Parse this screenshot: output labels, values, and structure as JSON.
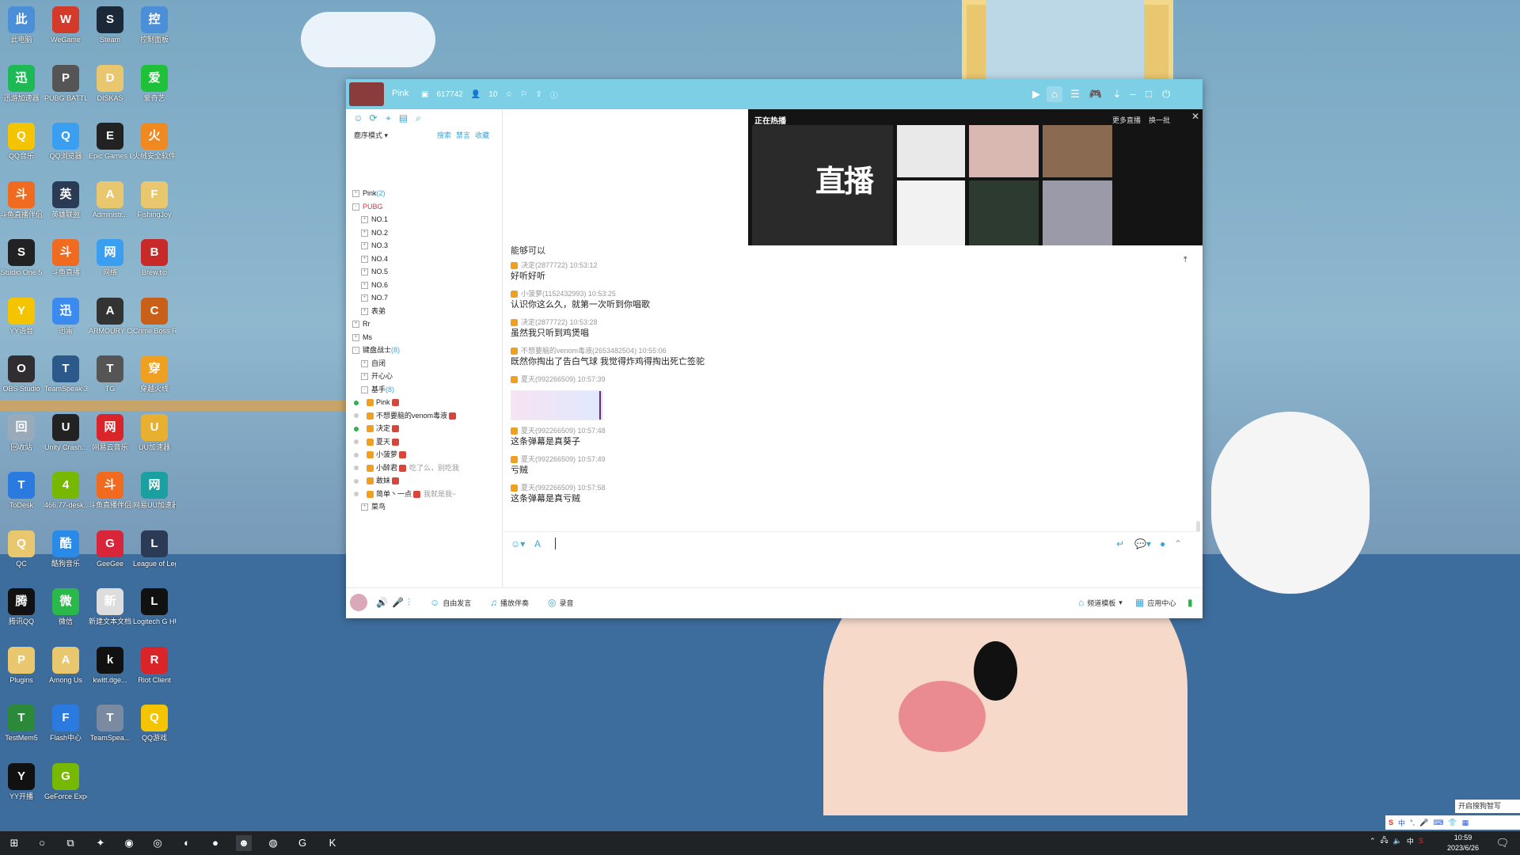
{
  "desktop": {
    "icons": [
      {
        "label": "此电脑",
        "color": "#4a8fd8"
      },
      {
        "label": "WeGame",
        "color": "#d43a2a"
      },
      {
        "label": "Steam",
        "color": "#1b2838"
      },
      {
        "label": "控制面板",
        "color": "#4a8fd8"
      },
      {
        "label": "迅游加速器",
        "color": "#1db954"
      },
      {
        "label": "PUBG BATTLEGR...",
        "color": "#555"
      },
      {
        "label": "DISKAS",
        "color": "#e8c76f"
      },
      {
        "label": "爱奇艺",
        "color": "#1fc03a"
      },
      {
        "label": "QQ音乐",
        "color": "#f5c400"
      },
      {
        "label": "QQ浏览器",
        "color": "#3a9ff0"
      },
      {
        "label": "Epic Games Launcher",
        "color": "#222"
      },
      {
        "label": "火绒安全软件",
        "color": "#f08a20"
      },
      {
        "label": "斗鱼直播伴侣",
        "color": "#f06a20"
      },
      {
        "label": "英雄联盟",
        "color": "#2b3a55"
      },
      {
        "label": "Administr...",
        "color": "#e8c76f"
      },
      {
        "label": "FishingJoy",
        "color": "#e8c76f"
      },
      {
        "label": "Studio One 5",
        "color": "#222"
      },
      {
        "label": "斗鱼直播",
        "color": "#f06a20"
      },
      {
        "label": "网络",
        "color": "#3a9ff0"
      },
      {
        "label": "Brew.tip",
        "color": "#c82a2a"
      },
      {
        "label": "YY语音",
        "color": "#f5c400"
      },
      {
        "label": "迅雷",
        "color": "#3a8af0"
      },
      {
        "label": "ARMOURY CRATE",
        "color": "#333"
      },
      {
        "label": "Crime Boss Rockay City",
        "color": "#c8601a"
      },
      {
        "label": "OBS Studio",
        "color": "#302e31"
      },
      {
        "label": "TeamSpeak 3",
        "color": "#2b5a8a"
      },
      {
        "label": "TG",
        "color": "#555"
      },
      {
        "label": "穿越火线",
        "color": "#f0a020"
      },
      {
        "label": "回收站",
        "color": "#9ab"
      },
      {
        "label": "Unity Crash...",
        "color": "#222"
      },
      {
        "label": "网易云音乐",
        "color": "#d9252a"
      },
      {
        "label": "UU加速器",
        "color": "#e8b030"
      },
      {
        "label": "ToDesk",
        "color": "#2a7ae0"
      },
      {
        "label": "466.77-desk...",
        "color": "#76b900"
      },
      {
        "label": "斗鱼直播伴侣",
        "color": "#f06a20"
      },
      {
        "label": "网易UU加速器",
        "color": "#1aa0a0"
      },
      {
        "label": "QC",
        "color": "#e8c76f"
      },
      {
        "label": "酷狗音乐",
        "color": "#2a8ae8"
      },
      {
        "label": "GeeGee",
        "color": "#d9253a"
      },
      {
        "label": "League of Legends...",
        "color": "#2b3a55"
      },
      {
        "label": "腾讯QQ",
        "color": "#111"
      },
      {
        "label": "微信",
        "color": "#2ab84a"
      },
      {
        "label": "新建文本文档",
        "color": "#ddd"
      },
      {
        "label": "Logitech G HUB",
        "color": "#111"
      },
      {
        "label": "Plugins",
        "color": "#e8c76f"
      },
      {
        "label": "Among Us",
        "color": "#e8c76f"
      },
      {
        "label": "kwitt.dge...",
        "color": "#111"
      },
      {
        "label": "Riot Client",
        "color": "#d9252a"
      },
      {
        "label": "TestMem5",
        "color": "#2a8a3a"
      },
      {
        "label": "Flash中心",
        "color": "#2a7ae0"
      },
      {
        "label": "TeamSpea...",
        "color": "#7a8aa0"
      },
      {
        "label": "QQ游戏",
        "color": "#f5c400"
      },
      {
        "label": "YY开播",
        "color": "#111"
      },
      {
        "label": "GeForce Experience",
        "color": "#76b900"
      }
    ]
  },
  "titlebar": {
    "name": "Pink",
    "channel_id": "617742",
    "online_count": "10"
  },
  "left_panel": {
    "sort_mode": "鹿序模式",
    "links": [
      "搜索",
      "禁言",
      "收藏"
    ],
    "tree": [
      {
        "label": "Pink",
        "count": "(2)",
        "level": 0,
        "expand": "+"
      },
      {
        "label": "PUBG",
        "count": "",
        "level": 0,
        "expand": "-",
        "red": true
      },
      {
        "label": "NO.1",
        "count": "",
        "level": 1,
        "expand": "+"
      },
      {
        "label": "NO.2",
        "count": "",
        "level": 1,
        "expand": "+"
      },
      {
        "label": "NO.3",
        "count": "",
        "level": 1,
        "expand": "+"
      },
      {
        "label": "NO.4",
        "count": "",
        "level": 1,
        "expand": "+"
      },
      {
        "label": "NO.5",
        "count": "",
        "level": 1,
        "expand": "+"
      },
      {
        "label": "NO.6",
        "count": "",
        "level": 1,
        "expand": "+"
      },
      {
        "label": "NO.7",
        "count": "",
        "level": 1,
        "expand": "+"
      },
      {
        "label": "表弟",
        "count": "",
        "level": 1,
        "expand": "+"
      },
      {
        "label": "Rr",
        "count": "",
        "level": 0,
        "expand": "+"
      },
      {
        "label": "Ms",
        "count": "",
        "level": 0,
        "expand": "+"
      },
      {
        "label": "键盘战士",
        "count": "(8)",
        "level": 0,
        "expand": "-"
      },
      {
        "label": "自闭",
        "count": "",
        "level": 1,
        "expand": "+"
      },
      {
        "label": "开心心",
        "count": "",
        "level": 1,
        "expand": "+"
      },
      {
        "label": "基手",
        "count": "(8)",
        "level": 1,
        "expand": "-"
      }
    ],
    "users": [
      {
        "name": "Pink",
        "online": true,
        "sig": ""
      },
      {
        "name": "不想要脑的venom毒液",
        "online": false,
        "sig": ""
      },
      {
        "name": "决定",
        "online": true,
        "sig": ""
      },
      {
        "name": "夏天",
        "online": false,
        "sig": ""
      },
      {
        "name": "小菠萝",
        "online": false,
        "sig": ""
      },
      {
        "name": "小醉君",
        "online": false,
        "sig": "吃了么，别吃我"
      },
      {
        "name": "敢妹",
        "online": false,
        "sig": ""
      },
      {
        "name": "简单丶一点",
        "online": false,
        "sig": "我就是我~"
      }
    ],
    "tail": {
      "label": "菜鸟",
      "expand": "+"
    }
  },
  "live": {
    "heading": "正在热播",
    "more": "更多直播",
    "refresh": "换一批",
    "banner_text": "直播"
  },
  "chat": {
    "cut_line": "能够可以",
    "messages": [
      {
        "meta": "决定(2877722)  10:53:12",
        "text": "好听好听"
      },
      {
        "meta": "小菠萝(1152432993)  10:53:25",
        "text": "认识你这么久，就第一次听到你唱歌"
      },
      {
        "meta": "决定(2877722)  10:53:28",
        "text": "虽然我只听到鸡煲唱"
      },
      {
        "meta": "不想要脑的venom毒液(2653482504)  10:55:06",
        "text": "既然你掏出了告白气球 我觉得炸鸡得掏出死亡签驼"
      },
      {
        "meta": "夏天(992266509)  10:57:39",
        "text": "",
        "image": true
      },
      {
        "meta": "夏天(992266509)  10:57:48",
        "text": "这条弹幕是真葵子"
      },
      {
        "meta": "夏天(992266509)  10:57:49",
        "text": "亏贼"
      },
      {
        "meta": "夏天(992266509)  10:57:58",
        "text": "这条弹幕是真亏贼"
      }
    ]
  },
  "bottom_bar": {
    "free_speak": "自由发言",
    "play_accomp": "播放伴奏",
    "record": "录音",
    "channel_template": "频道模板",
    "app_center": "应用中心"
  },
  "taskbar": {
    "time": "10:59",
    "date": "2023/6/26",
    "ime": "中",
    "notify": "开启搜狗智写"
  }
}
